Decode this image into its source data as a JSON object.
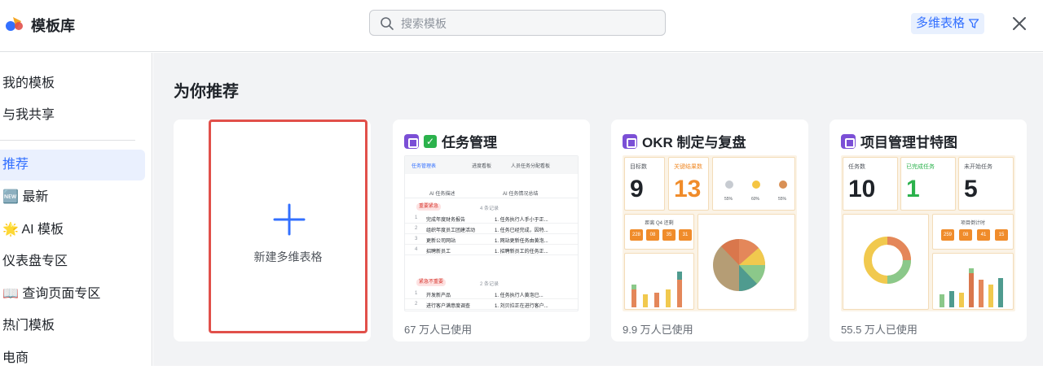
{
  "header": {
    "title": "模板库",
    "search_placeholder": "搜索模板",
    "filter_label": "多维表格"
  },
  "sidebar": {
    "items": [
      {
        "label": "我的模板"
      },
      {
        "label": "与我共享"
      },
      {
        "label": "推荐"
      },
      {
        "label": "🆕 最新"
      },
      {
        "label": "🌟 AI 模板"
      },
      {
        "label": "仪表盘专区"
      },
      {
        "label": "📖 查询页面专区"
      },
      {
        "label": "热门模板"
      },
      {
        "label": "电商"
      }
    ]
  },
  "main": {
    "section_title": "为你推荐",
    "new_card_label": "新建多维表格",
    "cards": [
      {
        "title": "任务管理",
        "usage": "67 万人已使用"
      },
      {
        "title": "OKR 制定与复盘",
        "usage": "9.9 万人已使用"
      },
      {
        "title": "项目管理甘特图",
        "usage": "55.5 万人已使用"
      }
    ],
    "task_preview": {
      "tabs": [
        "任务管理表",
        "进度看板",
        "人员任务分配看板"
      ],
      "col1": "AI 任务描述",
      "col2": "AI 任务情况总结",
      "group1": "重要紧急",
      "group1_count": "4 条记录",
      "group2": "紧急不重要",
      "group2_count": "2 条记录",
      "rows1": [
        {
          "n": "1",
          "task": "完成年度财务报告",
          "sum": "1. 任务执行人手小于正..."
        },
        {
          "n": "2",
          "task": "组织年度员工团建活动",
          "sum": "1. 任务已经完成，因特..."
        },
        {
          "n": "3",
          "task": "更新公司网站",
          "sum": "1. 网站更新任务由黄泡..."
        },
        {
          "n": "4",
          "task": "招聘新员工",
          "sum": "1. 招聘新员工的任务正..."
        }
      ],
      "rows2": [
        {
          "n": "1",
          "task": "开发新产品",
          "sum": "1. 任务执行人黄泡已..."
        },
        {
          "n": "2",
          "task": "进行客户满意度调查",
          "sum": "1. 刘贝拉正在进行客户..."
        }
      ]
    },
    "okr_preview": {
      "target_label": "目标数",
      "target_value": "9",
      "kr_label": "关键结果数",
      "kr_value": "13",
      "countdown_label": "距离 Q4 还剩",
      "countdown": [
        "228",
        "08",
        "35",
        "31"
      ],
      "pcts": [
        "55%",
        "60%",
        "55%"
      ]
    },
    "gantt_preview": {
      "task_label": "任务数",
      "task_value": "10",
      "done_label": "已完成任务",
      "done_value": "1",
      "todo_label": "未开始任务",
      "todo_value": "5",
      "countdown_label": "项目倒计时",
      "countdown": [
        "259",
        "08",
        "41",
        "15"
      ]
    }
  },
  "colors": {
    "accent": "#3370ff",
    "highlight_border": "#e1504a",
    "kr_orange": "#f08c2b",
    "done_green": "#2bb24c",
    "template_icon": "#7b4fd6"
  }
}
